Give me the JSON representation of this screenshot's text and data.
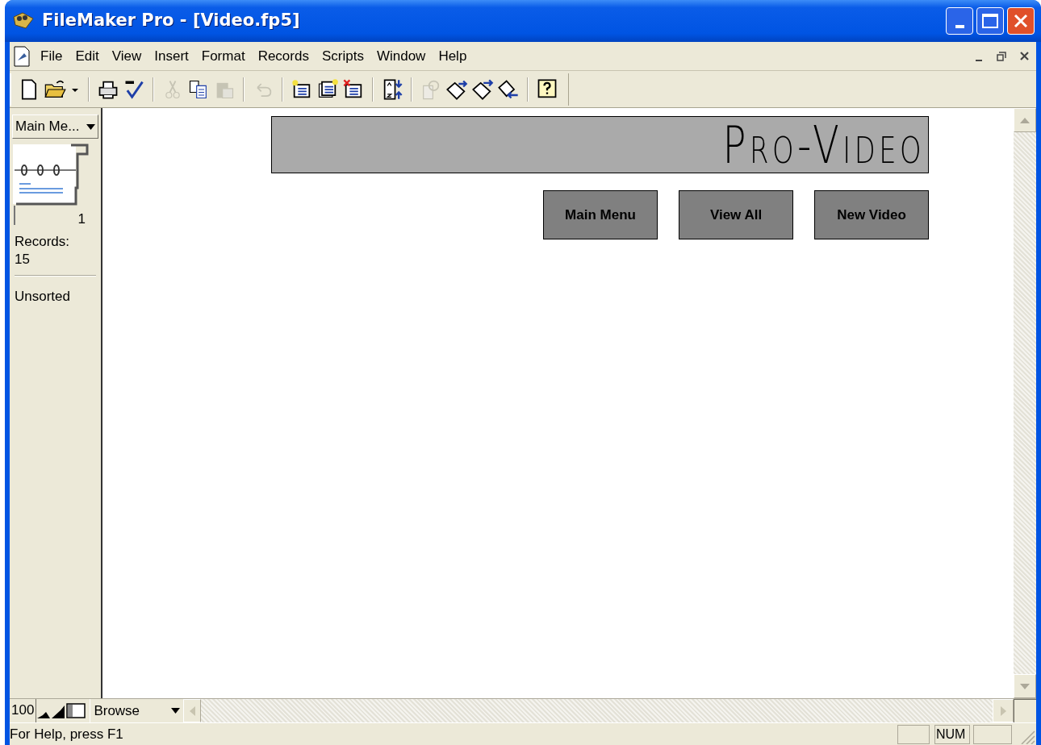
{
  "window": {
    "title": "FileMaker Pro - [Video.fp5]"
  },
  "menu": [
    "File",
    "Edit",
    "View",
    "Insert",
    "Format",
    "Records",
    "Scripts",
    "Window",
    "Help"
  ],
  "toolbar": [
    [
      {
        "kind": "new",
        "disabled": false
      },
      {
        "kind": "open",
        "disabled": false
      },
      {
        "kind": "caret",
        "disabled": false
      }
    ],
    [
      {
        "kind": "print",
        "disabled": false
      },
      {
        "kind": "spell",
        "disabled": false
      }
    ],
    [
      {
        "kind": "cut",
        "disabled": true
      },
      {
        "kind": "copy",
        "disabled": false
      },
      {
        "kind": "paste",
        "disabled": true
      }
    ],
    [
      {
        "kind": "undo",
        "disabled": true
      }
    ],
    [
      {
        "kind": "new_record",
        "disabled": false
      },
      {
        "kind": "duplicate",
        "disabled": false
      },
      {
        "kind": "delete",
        "disabled": false
      }
    ],
    [
      {
        "kind": "sort",
        "disabled": false
      }
    ],
    [
      {
        "kind": "find",
        "disabled": true
      },
      {
        "kind": "import",
        "disabled": false
      },
      {
        "kind": "export",
        "disabled": false
      },
      {
        "kind": "replace",
        "disabled": false
      }
    ],
    [
      {
        "kind": "help",
        "disabled": false
      }
    ]
  ],
  "layout_menu": {
    "value": "Main Me..."
  },
  "book": {
    "page": "1"
  },
  "records": {
    "label": "Records:",
    "count": "15"
  },
  "sort_status": "Unsorted",
  "header": {
    "title": "Pro-Video"
  },
  "buttons": [
    "Main Menu",
    "View All",
    "New Video"
  ],
  "zoom": "100",
  "mode": "Browse",
  "status_bar": {
    "help": "For Help, press F1",
    "indicator": "NUM"
  }
}
